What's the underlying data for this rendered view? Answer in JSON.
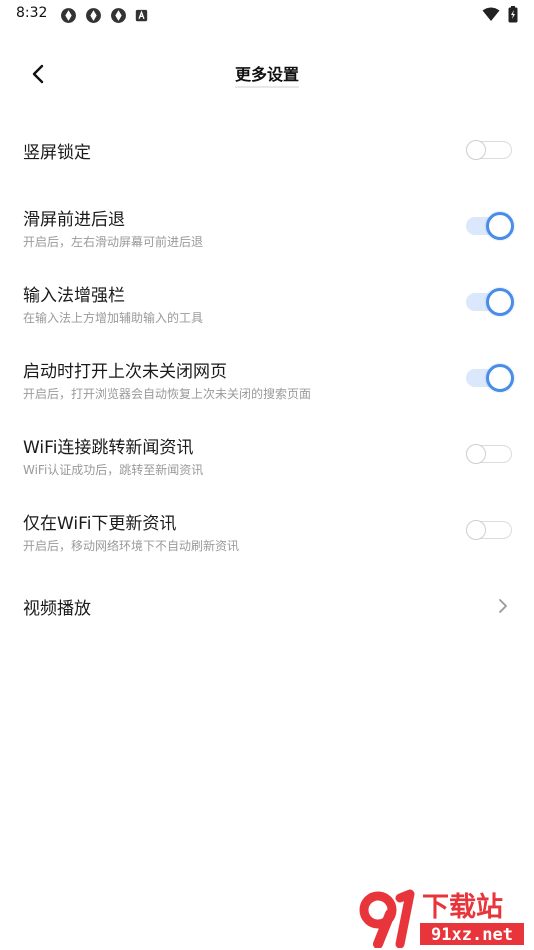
{
  "status_bar": {
    "time": "8:32",
    "left_icons": [
      "sync-icon",
      "sync-icon",
      "sync-icon",
      "a-badge-icon"
    ],
    "right_icons": [
      "wifi-icon",
      "battery-charging-icon"
    ]
  },
  "header": {
    "title": "更多设置",
    "back_icon": "chevron-left-icon"
  },
  "settings": {
    "portrait_lock": {
      "title": "竖屏锁定",
      "enabled": false
    },
    "swipe_nav": {
      "title": "滑屏前进后退",
      "subtitle": "开启后，左右滑动屏幕可前进后退",
      "enabled": true
    },
    "ime_bar": {
      "title": "输入法增强栏",
      "subtitle": "在输入法上方增加辅助输入的工具",
      "enabled": true
    },
    "restore_tabs": {
      "title": "启动时打开上次未关闭网页",
      "subtitle": "开启后，打开浏览器会自动恢复上次未关闭的搜索页面",
      "enabled": true
    },
    "wifi_news": {
      "title": "WiFi连接跳转新闻资讯",
      "subtitle": "WiFi认证成功后，跳转至新闻资讯",
      "enabled": false
    },
    "wifi_only_update": {
      "title": "仅在WiFi下更新资讯",
      "subtitle": "开启后，移动网络环境下不自动刷新资讯",
      "enabled": false
    },
    "video_playback": {
      "title": "视频播放"
    }
  },
  "watermark": {
    "brand": "下载站",
    "domain": "91xz.net"
  },
  "colors": {
    "accent": "#4a8de8",
    "track_on": "#dbe7fb",
    "watermark_red": "#e8353b"
  }
}
